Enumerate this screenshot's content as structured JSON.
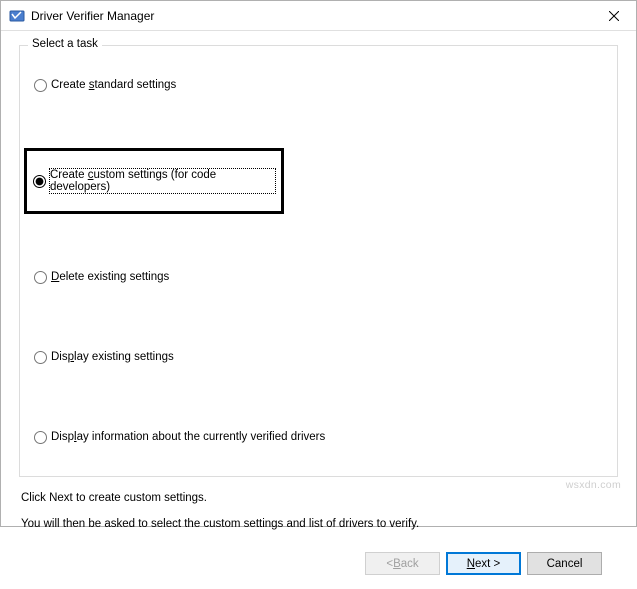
{
  "window": {
    "title": "Driver Verifier Manager",
    "close_tooltip": "Close"
  },
  "groupbox": {
    "legend": "Select a task",
    "options": {
      "create_standard": "Create standard settings",
      "create_custom": "Create custom settings (for code developers)",
      "delete_existing": "Delete existing settings",
      "display_existing": "Display existing settings",
      "display_information": "Display information about the currently verified drivers"
    },
    "selected": "create_custom"
  },
  "instructions": {
    "line1": "Click Next to create custom settings.",
    "line2": "You will then be asked to select the custom settings and list of drivers to verify."
  },
  "buttons": {
    "back": "< Back",
    "next": "Next >",
    "cancel": "Cancel"
  },
  "underlines": {
    "back": "B",
    "next": "N",
    "standard": "s",
    "custom": "c",
    "delete": "D",
    "display_existing": "p",
    "display_info": "l"
  },
  "watermark": "wsxdn.com"
}
